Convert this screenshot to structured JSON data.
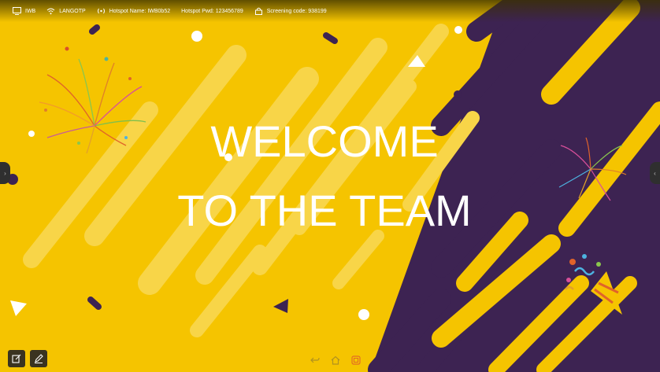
{
  "status_bar": {
    "device": "IWB",
    "network": "LANGOTP",
    "hotspot_name": "Hotspot Name: IWB0b52",
    "hotspot_pwd": "Hotspot Pwd: 123456789",
    "screening_code": "Screening code: 938199"
  },
  "slide": {
    "title_line1": "WELCOME",
    "title_line2": "TO THE TEAM"
  },
  "colors": {
    "background": "#f5c400",
    "accent_purple": "#3d2352",
    "text": "#ffffff"
  },
  "icons": {
    "left_tab": "chevron-icon",
    "right_tab": "chevron-icon",
    "annotate": "annotate-icon",
    "pen": "pen-icon",
    "dock": [
      "back-icon",
      "home-icon",
      "apps-icon"
    ]
  }
}
